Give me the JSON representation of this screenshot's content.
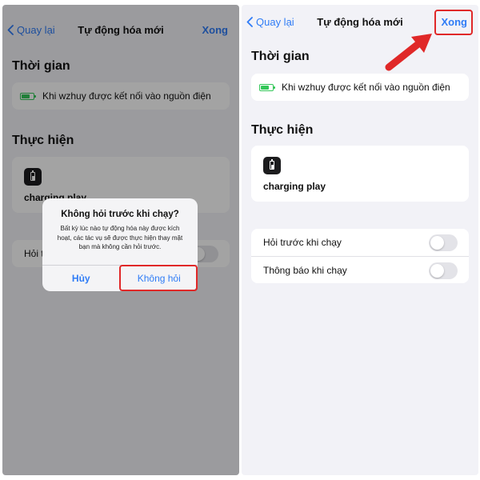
{
  "left": {
    "nav": {
      "back_label": "Quay lại",
      "title": "Tự động hóa mới",
      "done_label": "Xong"
    },
    "section_time": "Thời gian",
    "trigger_text": "Khi wzhuy được kết nối vào nguồn điện",
    "section_action": "Thực hiện",
    "action_label": "charging play",
    "toggle_partial_label": "Hỏi t",
    "alert": {
      "title": "Không hỏi trước khi chạy?",
      "message": "Bất kỳ lúc nào tự động hóa này được kích hoạt, các tác vụ sẽ được thực hiện thay mặt bạn mà không cần hỏi trước.",
      "cancel_label": "Hủy",
      "confirm_label": "Không hỏi"
    }
  },
  "right": {
    "nav": {
      "back_label": "Quay lại",
      "title": "Tự động hóa mới",
      "done_label": "Xong"
    },
    "section_time": "Thời gian",
    "trigger_text": "Khi wzhuy được kết nối vào nguồn điện",
    "section_action": "Thực hiện",
    "action_label": "charging play",
    "toggles": [
      {
        "label": "Hỏi trước khi chạy",
        "on": false
      },
      {
        "label": "Thông báo khi chạy",
        "on": false
      }
    ]
  },
  "colors": {
    "accent": "#2f7cf6",
    "highlight": "#e02828",
    "battery": "#34c759"
  },
  "icons": [
    "chevron-left-icon",
    "battery-charging-icon",
    "battery-icon",
    "arrow-icon"
  ]
}
